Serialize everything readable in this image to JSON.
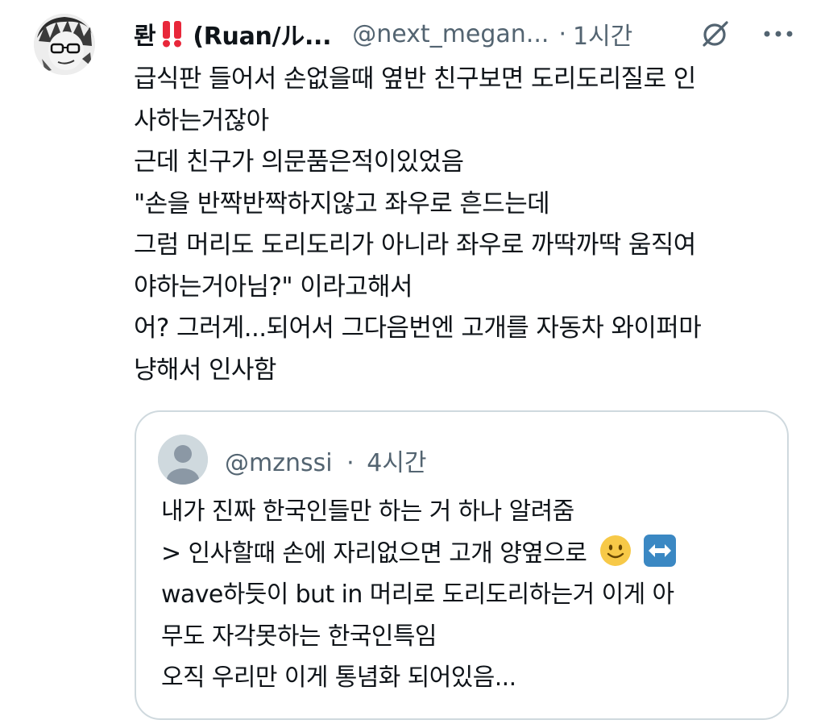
{
  "post": {
    "display_name": "롼",
    "display_name_tail": "(Ruan/ル...",
    "handle": "@next_megan...",
    "separator": "·",
    "time": "1시간",
    "lines": [
      "급식판 들어서 손없을때 옆반 친구보면 도리도리질로 인",
      "사하는거잖아",
      "근데 친구가 의문품은적이있었음",
      "\"손을 반짝반짝하지않고 좌우로 흔드는데",
      "그럼 머리도 도리도리가 아니라 좌우로 까딱까딱 움직여",
      "야하는거아님?\" 이라고해서",
      "어? 그러게...되어서 그다음번엔 고개를 자동차 와이퍼마",
      "냥해서 인사함"
    ],
    "icons": {
      "name_badge": "double-exclamation-emoji",
      "grok": "grok-icon",
      "more": "more-dots-icon"
    }
  },
  "quote": {
    "handle": "@mznssi",
    "separator": "·",
    "time": "4시간",
    "line1": "내가 진짜 한국인들만 하는 거 하나 알려줌",
    "line2_prefix": "> 인사할때 손에 자리없으면 고개 양옆으로",
    "line3": "wave하듯이 but in 머리로 도리도리하는거 이게 아",
    "line4": "무도 자각못하는 한국인특임",
    "line5": "오직 우리만 이게 통념화 되어있음...",
    "emoji": [
      "slightly-smiling-face",
      "left-right-arrow"
    ]
  },
  "colors": {
    "text": "#0f1419",
    "secondary": "#536471",
    "border": "#cfd9de",
    "badge_red": "#e8273a",
    "arrow_blue": "#3b88c3"
  }
}
